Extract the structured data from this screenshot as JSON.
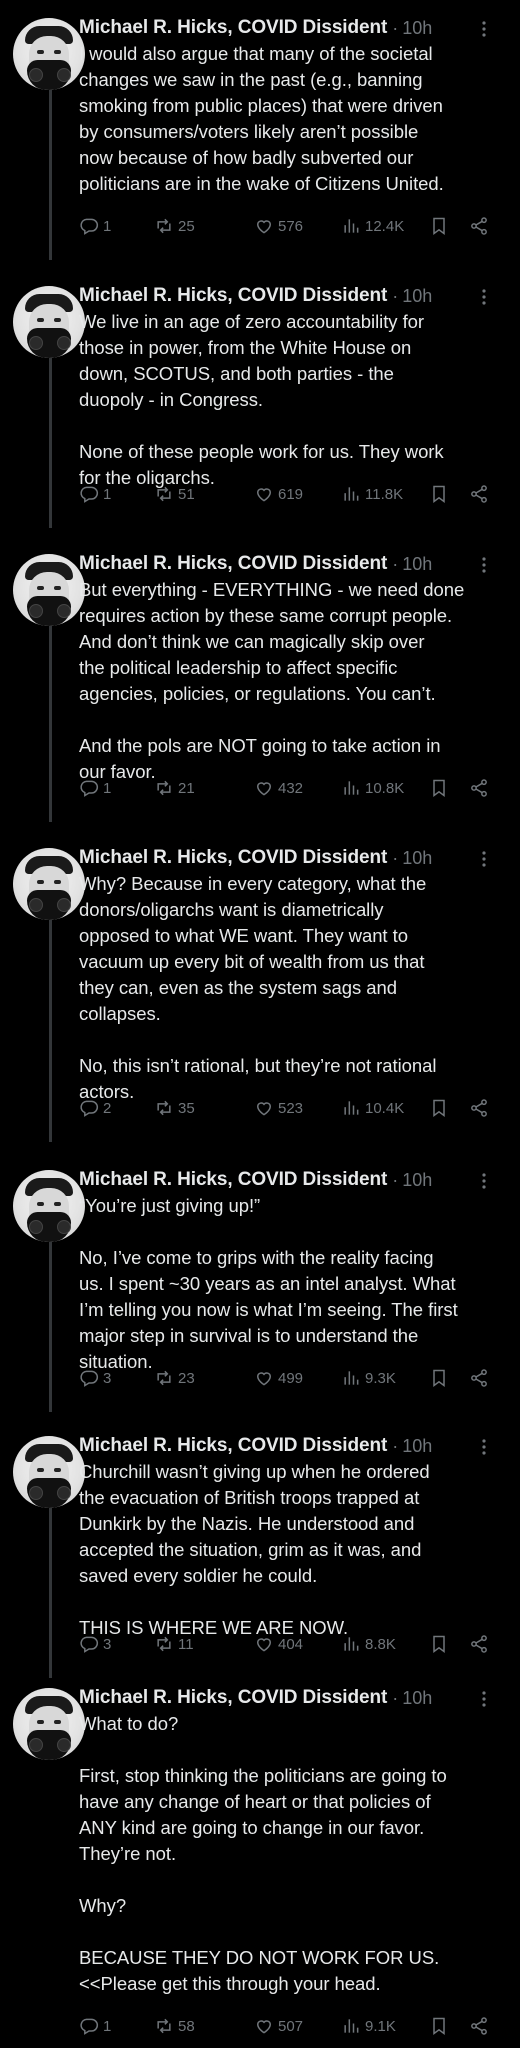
{
  "colors": {
    "background": "#000000",
    "text": "#e7e9ea",
    "muted": "#71767b",
    "thread_line": "#333639"
  },
  "tweets": [
    {
      "name": "Michael R. Hicks, COVID Dissident",
      "separator": "·",
      "time": "10h",
      "text": "I would also argue that many of the societal\nchanges we saw in the past (e.g., banning\nsmoking from public places) that were driven\nby consumers/voters likely aren’t possible\nnow because of how badly subverted our\npoliticians are in the wake of Citizens United.",
      "replies": "1",
      "reposts": "25",
      "likes": "576",
      "views": "12.4K"
    },
    {
      "name": "Michael R. Hicks, COVID Dissident",
      "separator": "·",
      "time": "10h",
      "text": "We live in an age of zero accountability for\nthose in power, from the White House on\ndown, SCOTUS, and both parties - the\nduopoly - in Congress.\n\nNone of these people work for us. They work\nfor the oligarchs.",
      "replies": "1",
      "reposts": "51",
      "likes": "619",
      "views": "11.8K"
    },
    {
      "name": "Michael R. Hicks, COVID Dissident",
      "separator": "·",
      "time": "10h",
      "text": "But everything - EVERYTHING - we need done\nrequires action by these same corrupt people.\nAnd don’t think we can magically skip over\nthe political leadership to affect specific\nagencies, policies, or regulations. You can’t.\n\nAnd the pols are NOT going to take action in\nour favor.",
      "replies": "1",
      "reposts": "21",
      "likes": "432",
      "views": "10.8K"
    },
    {
      "name": "Michael R. Hicks, COVID Dissident",
      "separator": "·",
      "time": "10h",
      "text": "Why? Because in every category, what the\ndonors/oligarchs want is diametrically\nopposed to what WE want. They want to\nvacuum up every bit of wealth from us that\nthey can, even as the system sags and\ncollapses.\n\nNo, this isn’t rational, but they’re not rational\nactors.",
      "replies": "2",
      "reposts": "35",
      "likes": "523",
      "views": "10.4K"
    },
    {
      "name": "Michael R. Hicks, COVID Dissident",
      "separator": "·",
      "time": "10h",
      "text": "“You’re just giving up!”\n\nNo, I’ve come to grips with the reality facing\nus. I spent ~30 years as an intel analyst. What\nI’m telling you now is what I’m seeing. The first\nmajor step in survival is to understand the\nsituation.",
      "replies": "3",
      "reposts": "23",
      "likes": "499",
      "views": "9.3K"
    },
    {
      "name": "Michael R. Hicks, COVID Dissident",
      "separator": "·",
      "time": "10h",
      "text": "Churchill wasn’t giving up when he ordered\nthe evacuation of British troops trapped at\nDunkirk by the Nazis. He understood and\naccepted the situation, grim as it was, and\nsaved every soldier he could.\n\nTHIS IS WHERE WE ARE NOW.",
      "replies": "3",
      "reposts": "11",
      "likes": "404",
      "views": "8.8K"
    },
    {
      "name": "Michael R. Hicks, COVID Dissident",
      "separator": "·",
      "time": "10h",
      "text": "What to do?\n\nFirst, stop thinking the politicians are going to\nhave any change of heart or that policies of\nANY kind are going to change in our favor.\nThey’re not.\n\nWhy?\n\nBECAUSE THEY DO NOT WORK FOR US.\n<<Please get this through your head.",
      "replies": "1",
      "reposts": "58",
      "likes": "507",
      "views": "9.1K"
    }
  ]
}
